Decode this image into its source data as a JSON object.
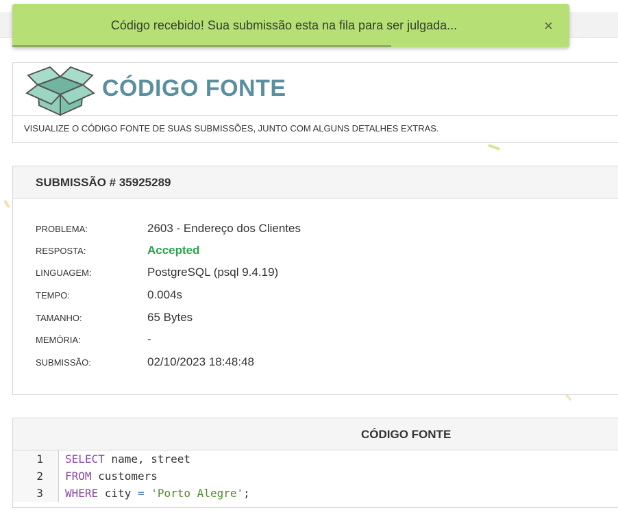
{
  "toast": {
    "message": "Código recebido! Sua submissão esta na fila para ser julgada...",
    "close_icon": "×",
    "progress": 0.68
  },
  "header": {
    "title": "CÓDIGO FONTE",
    "subtitle": "VISUALIZE O CÓDIGO FONTE DE SUAS SUBMISSÕES, JUNTO COM ALGUNS DETALHES EXTRAS.",
    "logo_icon": "open-box-icon"
  },
  "submission": {
    "title": "SUBMISSÃO # 35925289",
    "details": [
      {
        "label": "PROBLEMA:",
        "value": "2603 - Endereço dos Clientes"
      },
      {
        "label": "RESPOSTA:",
        "value": "Accepted"
      },
      {
        "label": "LINGUAGEM:",
        "value": "PostgreSQL (psql 9.4.19)"
      },
      {
        "label": "TEMPO:",
        "value": "0.004s"
      },
      {
        "label": "TAMANHO:",
        "value": "65 Bytes"
      },
      {
        "label": "MEMÓRIA:",
        "value": "-"
      },
      {
        "label": "SUBMISSÃO:",
        "value": "02/10/2023 18:48:48"
      }
    ]
  },
  "source_code": {
    "title": "CÓDIGO FONTE",
    "lines": [
      {
        "number": "1",
        "keyword": "SELECT",
        "rest": " name, street"
      },
      {
        "number": "2",
        "keyword": "FROM",
        "rest": " customers"
      },
      {
        "number": "3",
        "keyword": "WHERE",
        "mid": " city ",
        "operator": "=",
        "string": " 'Porto Alegre'",
        "end": ";"
      }
    ]
  },
  "colors": {
    "toast_bg": "#b6df76",
    "title_blue": "#5a8fa0",
    "accepted_green": "#27a34a",
    "keyword_purple": "#8a49a8",
    "string_green": "#4c8b2b"
  }
}
